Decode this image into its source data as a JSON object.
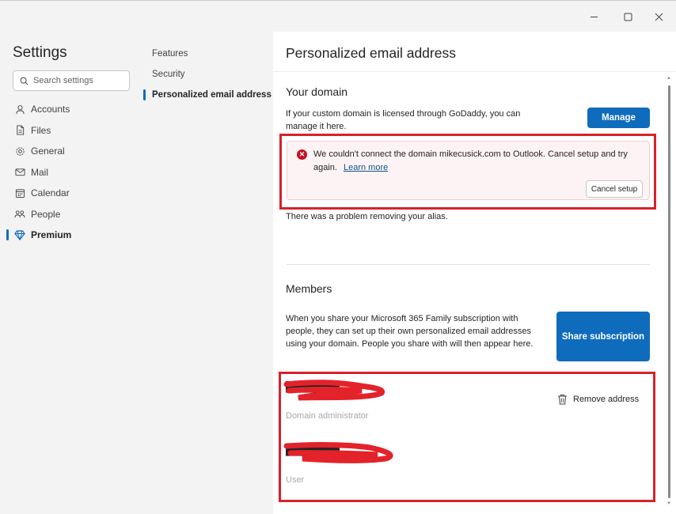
{
  "settings": {
    "title": "Settings",
    "search_placeholder": "Search settings",
    "categories": [
      {
        "label": "Accounts",
        "icon": "person-icon"
      },
      {
        "label": "Files",
        "icon": "file-icon"
      },
      {
        "label": "General",
        "icon": "gear-icon"
      },
      {
        "label": "Mail",
        "icon": "mail-icon"
      },
      {
        "label": "Calendar",
        "icon": "calendar-icon"
      },
      {
        "label": "People",
        "icon": "people-icon"
      },
      {
        "label": "Premium",
        "icon": "diamond-icon",
        "selected": true
      }
    ]
  },
  "subnav": {
    "items": [
      {
        "label": "Features"
      },
      {
        "label": "Security"
      },
      {
        "label": "Personalized email address",
        "selected": true
      }
    ]
  },
  "page": {
    "title": "Personalized email address",
    "your_domain": {
      "heading": "Your domain",
      "description": "If your custom domain is licensed through GoDaddy, you can manage it here.",
      "manage_label": "Manage",
      "error": {
        "message": "We couldn't connect the domain mikecusick.com to Outlook. Cancel setup and try again.",
        "link_label": "Learn more",
        "cancel_label": "Cancel setup"
      },
      "alias_error": "There was a problem removing your alias."
    },
    "members": {
      "heading": "Members",
      "description": "When you share your Microsoft 365 Family subscription with people, they can set up their own personalized email addresses using your domain. People you share with will then appear here.",
      "share_label": "Share subscription",
      "list": [
        {
          "role": "Domain administrator",
          "action": "Remove address"
        },
        {
          "role": "User"
        }
      ]
    }
  },
  "colors": {
    "accent": "#0f6cbd",
    "error": "#c50f1f",
    "annotation": "#d9212a"
  }
}
